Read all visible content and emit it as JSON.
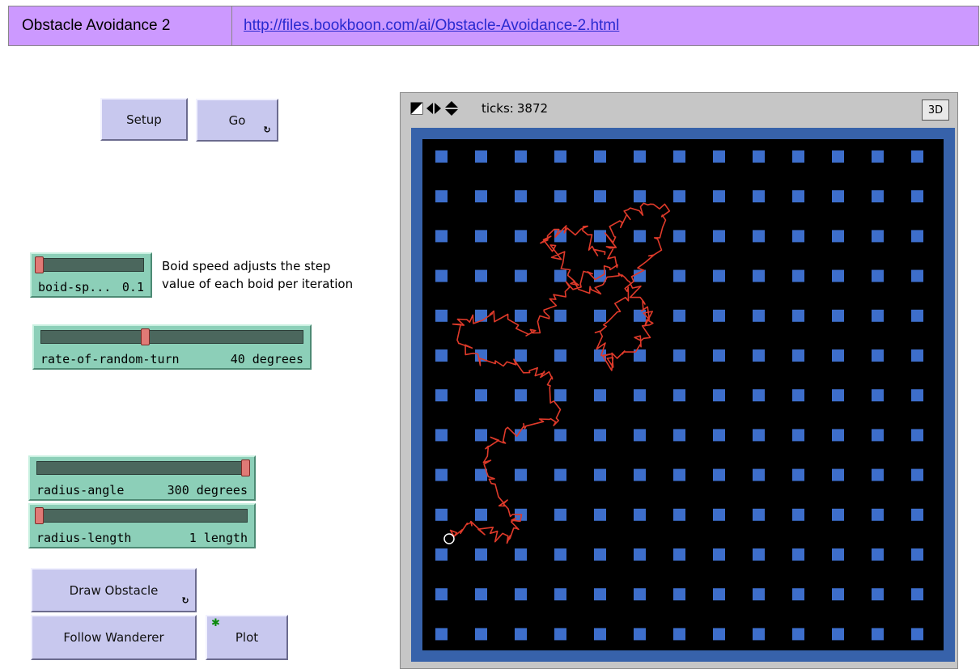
{
  "header": {
    "model_name": "Obstacle Avoidance 2",
    "url": "http://files.bookboon.com/ai/Obstacle-Avoidance-2.html"
  },
  "buttons": {
    "setup": "Setup",
    "go": "Go",
    "draw_obstacle": "Draw Obstacle",
    "follow_wanderer": "Follow Wanderer",
    "plot": "Plot"
  },
  "sliders": {
    "boid_speed": {
      "name": "boid-sp...",
      "value": "0.1",
      "level": 0.0
    },
    "rate_of_random_turn": {
      "name": "rate-of-random-turn",
      "value": "40 degrees",
      "level": 0.4
    },
    "radius_angle": {
      "name": "radius-angle",
      "value": "300 degrees",
      "level": 1.0
    },
    "radius_length": {
      "name": "radius-length",
      "value": "1 length",
      "level": 0.0
    }
  },
  "note": {
    "line1": "Boid speed adjusts the step",
    "line2": "value of each boid per iteration"
  },
  "view": {
    "ticks_label": "ticks:",
    "ticks_value": "3872",
    "btn_3d": "3D"
  },
  "colors": {
    "button": "#c8c8ee",
    "slider": "#8ccfb8",
    "world_border": "#3762aa",
    "obstacle": "#3d6ecb",
    "trail": "#e03a2a",
    "header": "#cc99ff"
  }
}
